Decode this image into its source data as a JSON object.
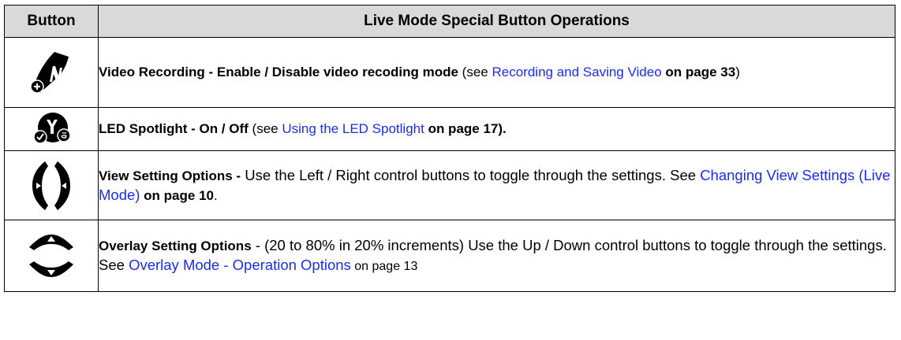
{
  "header": {
    "col_button": "Button",
    "col_ops": "Live Mode Special Button Operations"
  },
  "rows": [
    {
      "icon": "n-button-plus-icon",
      "title": "Video Recording - Enable / Disable video recoding mode",
      "see_open": " (see ",
      "link": "Recording and Saving Video",
      "page_ref": " on page 33",
      "close": ")"
    },
    {
      "icon": "y-button-check-icon",
      "title": "LED Spotlight - On / Off",
      "see_open": " (see ",
      "link": "Using the LED Spotlight",
      "page_ref": " on page 17",
      "close": ")."
    },
    {
      "icon": "left-right-arrows-icon",
      "title": "View Setting Options -",
      "text": " Use the Left / Right control buttons to toggle through the settings. See ",
      "link": "Changing View Settings (Live Mode)",
      "page_ref": " on page 10",
      "close": "."
    },
    {
      "icon": "up-down-arrows-icon",
      "title": "Overlay Setting Options",
      "text": " - (20 to 80% in 20% increments) Use the Up / Down control buttons to toggle through the settings. See ",
      "link": "Overlay Mode - Operation Options",
      "page_ref": " on page 13"
    }
  ]
}
